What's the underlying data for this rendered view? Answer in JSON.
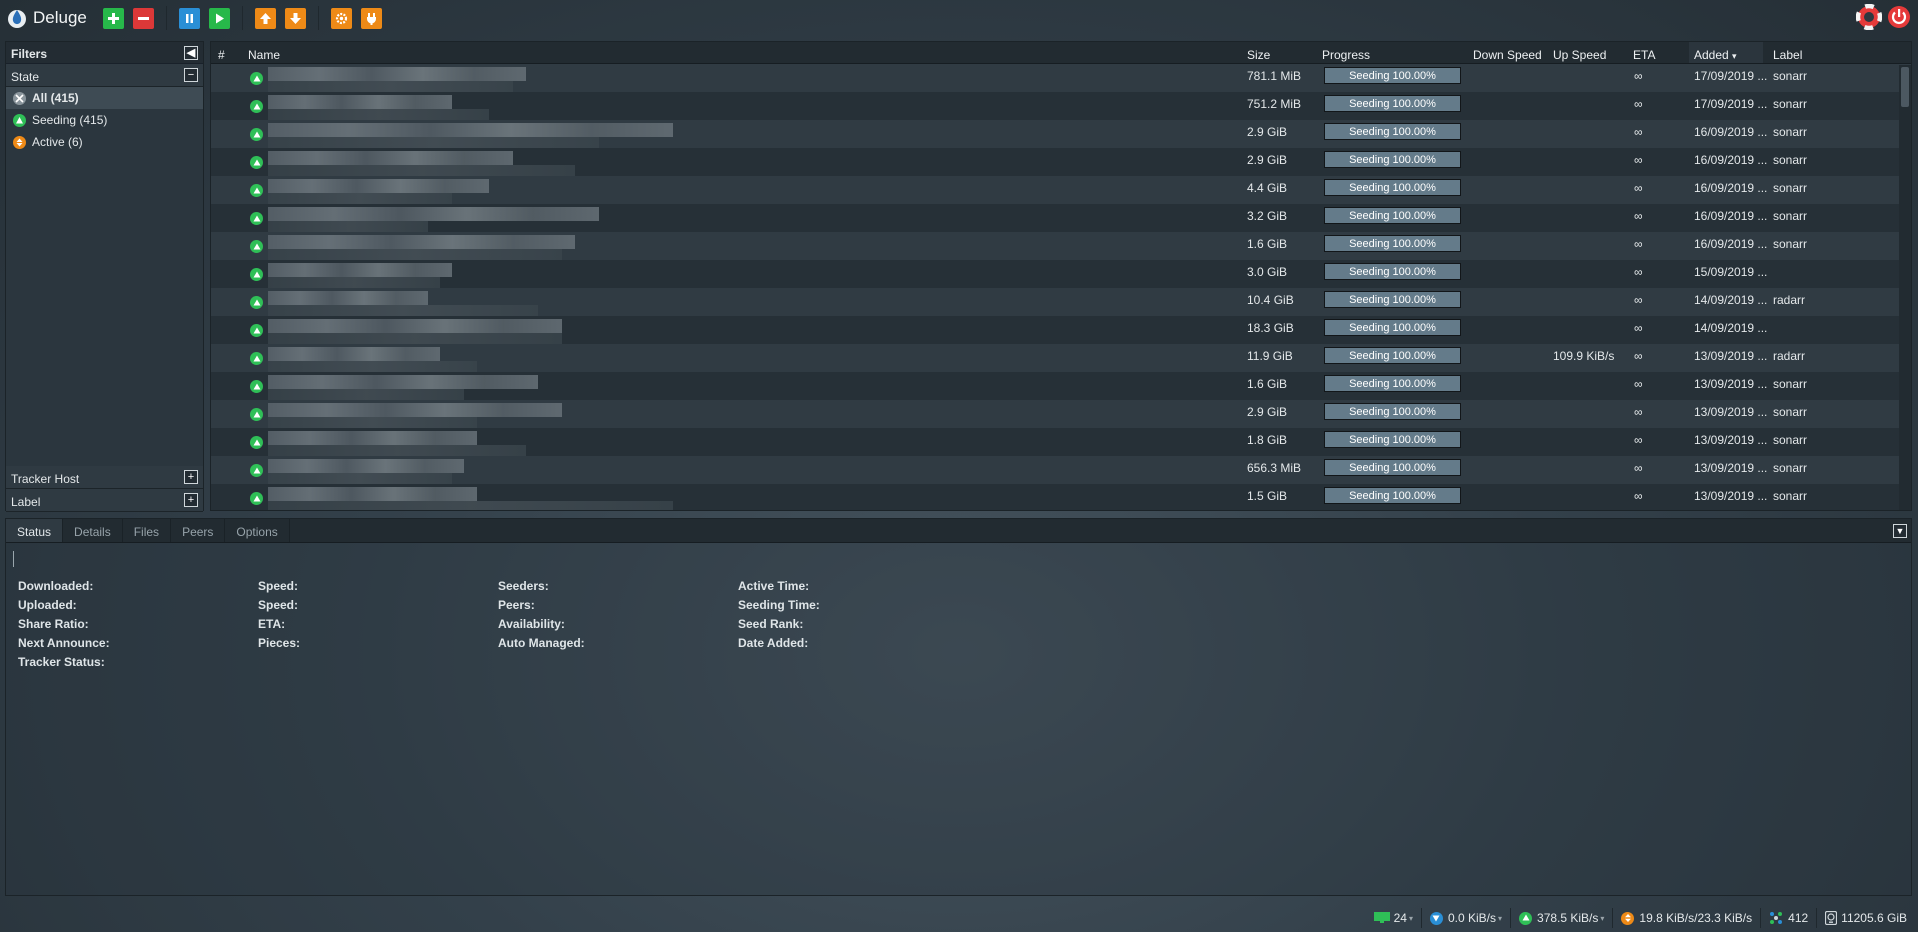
{
  "app": {
    "title": "Deluge"
  },
  "colors": {
    "accent": "#2a8fd6",
    "add": "#27b84a",
    "remove": "#dc3838",
    "orange": "#ee8a17",
    "seeding": "#2fbf57",
    "progress_fill": "#647b8a"
  },
  "toolbar": {
    "buttons": [
      {
        "icon": "add-icon"
      },
      {
        "icon": "remove-icon"
      },
      {
        "icon": "pause-icon"
      },
      {
        "icon": "resume-icon"
      },
      {
        "icon": "queue-up-icon"
      },
      {
        "icon": "queue-down-icon"
      },
      {
        "icon": "preferences-icon"
      },
      {
        "icon": "connection-manager-icon"
      }
    ],
    "right": [
      {
        "icon": "help-icon"
      },
      {
        "icon": "logout-icon"
      }
    ]
  },
  "filters": {
    "title": "Filters",
    "state": {
      "title": "State",
      "items": [
        {
          "label": "All (415)",
          "icon": "all-icon",
          "selected": true
        },
        {
          "label": "Seeding (415)",
          "icon": "seeding-icon"
        },
        {
          "label": "Active (6)",
          "icon": "active-icon"
        }
      ]
    },
    "tracker_host": "Tracker Host",
    "label": "Label"
  },
  "grid": {
    "columns": {
      "num": "#",
      "name": "Name",
      "size": "Size",
      "progress": "Progress",
      "down": "Down Speed",
      "up": "Up Speed",
      "eta": "ETA",
      "added": "Added",
      "label": "Label"
    },
    "rows": [
      {
        "size": "781.1 MiB",
        "progress": "Seeding 100.00%",
        "pct": 100,
        "up": "",
        "eta": "∞",
        "added": "17/09/2019 ...",
        "label": "sonarr"
      },
      {
        "size": "751.2 MiB",
        "progress": "Seeding 100.00%",
        "pct": 100,
        "up": "",
        "eta": "∞",
        "added": "17/09/2019 ...",
        "label": "sonarr"
      },
      {
        "size": "2.9 GiB",
        "progress": "Seeding 100.00%",
        "pct": 100,
        "up": "",
        "eta": "∞",
        "added": "16/09/2019 ...",
        "label": "sonarr"
      },
      {
        "size": "2.9 GiB",
        "progress": "Seeding 100.00%",
        "pct": 100,
        "up": "",
        "eta": "∞",
        "added": "16/09/2019 ...",
        "label": "sonarr"
      },
      {
        "size": "4.4 GiB",
        "progress": "Seeding 100.00%",
        "pct": 100,
        "up": "",
        "eta": "∞",
        "added": "16/09/2019 ...",
        "label": "sonarr"
      },
      {
        "size": "3.2 GiB",
        "progress": "Seeding 100.00%",
        "pct": 100,
        "up": "",
        "eta": "∞",
        "added": "16/09/2019 ...",
        "label": "sonarr"
      },
      {
        "size": "1.6 GiB",
        "progress": "Seeding 100.00%",
        "pct": 100,
        "up": "",
        "eta": "∞",
        "added": "16/09/2019 ...",
        "label": "sonarr"
      },
      {
        "size": "3.0 GiB",
        "progress": "Seeding 100.00%",
        "pct": 100,
        "up": "",
        "eta": "∞",
        "added": "15/09/2019 ...",
        "label": ""
      },
      {
        "size": "10.4 GiB",
        "progress": "Seeding 100.00%",
        "pct": 100,
        "up": "",
        "eta": "∞",
        "added": "14/09/2019 ...",
        "label": "radarr"
      },
      {
        "size": "18.3 GiB",
        "progress": "Seeding 100.00%",
        "pct": 100,
        "up": "",
        "eta": "∞",
        "added": "14/09/2019 ...",
        "label": ""
      },
      {
        "size": "11.9 GiB",
        "progress": "Seeding 100.00%",
        "pct": 100,
        "up": "109.9 KiB/s",
        "eta": "∞",
        "added": "13/09/2019 ...",
        "label": "radarr"
      },
      {
        "size": "1.6 GiB",
        "progress": "Seeding 100.00%",
        "pct": 100,
        "up": "",
        "eta": "∞",
        "added": "13/09/2019 ...",
        "label": "sonarr"
      },
      {
        "size": "2.9 GiB",
        "progress": "Seeding 100.00%",
        "pct": 100,
        "up": "",
        "eta": "∞",
        "added": "13/09/2019 ...",
        "label": "sonarr"
      },
      {
        "size": "1.8 GiB",
        "progress": "Seeding 100.00%",
        "pct": 100,
        "up": "",
        "eta": "∞",
        "added": "13/09/2019 ...",
        "label": "sonarr"
      },
      {
        "size": "656.3 MiB",
        "progress": "Seeding 100.00%",
        "pct": 100,
        "up": "",
        "eta": "∞",
        "added": "13/09/2019 ...",
        "label": "sonarr"
      },
      {
        "size": "1.5 GiB",
        "progress": "Seeding 100.00%",
        "pct": 100,
        "up": "",
        "eta": "∞",
        "added": "13/09/2019 ...",
        "label": "sonarr"
      }
    ]
  },
  "details": {
    "tabs": [
      "Status",
      "Details",
      "Files",
      "Peers",
      "Options"
    ],
    "fields": [
      [
        "Downloaded:",
        "Uploaded:",
        "Share Ratio:",
        "Next Announce:",
        "Tracker Status:"
      ],
      [
        "Speed:",
        "Speed:",
        "ETA:",
        "Pieces:"
      ],
      [
        "Seeders:",
        "Peers:",
        "Availability:",
        "Auto Managed:"
      ],
      [
        "Active Time:",
        "Seeding Time:",
        "Seed Rank:",
        "Date Added:"
      ]
    ]
  },
  "statusbar": {
    "connections": "24",
    "download": "0.0 KiB/s",
    "upload": "378.5 KiB/s",
    "protocol": "19.8 KiB/s/23.3 KiB/s",
    "dht": "412",
    "free_space": "11205.6 GiB"
  }
}
